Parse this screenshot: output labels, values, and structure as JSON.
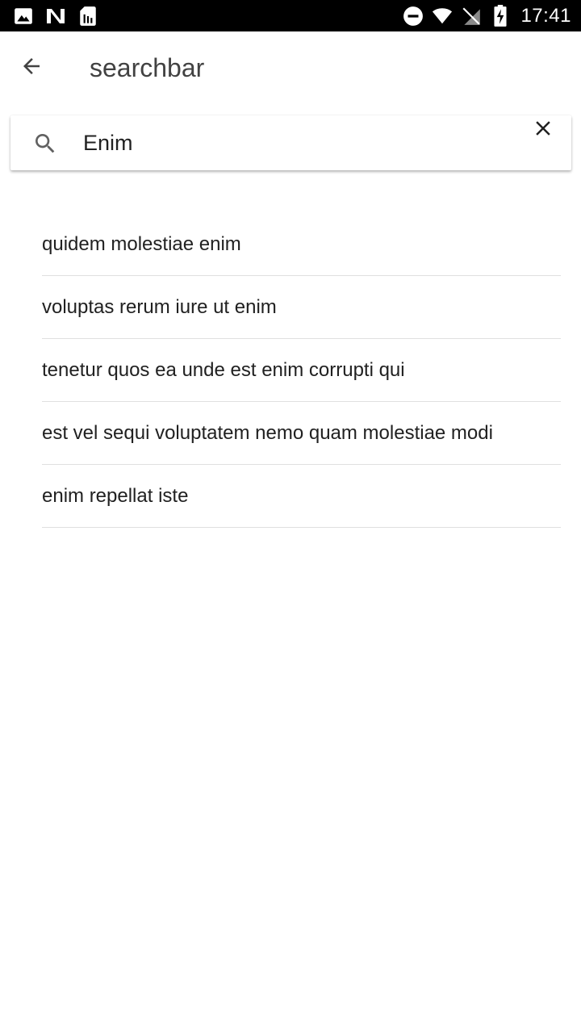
{
  "status_bar": {
    "time": "17:41",
    "left_icons": [
      "image-icon",
      "n-badge-icon",
      "sim-card-icon"
    ],
    "right_icons": [
      "do-not-disturb-icon",
      "wifi-icon",
      "no-sim-icon",
      "battery-charging-icon"
    ]
  },
  "app_bar": {
    "back_icon": "arrow-back-icon",
    "title": "searchbar"
  },
  "search": {
    "icon": "search-icon",
    "value": "Enim",
    "clear_icon": "close-icon"
  },
  "results": [
    {
      "text": "quidem molestiae enim"
    },
    {
      "text": "voluptas rerum iure ut enim"
    },
    {
      "text": "tenetur quos ea unde est enim corrupti qui"
    },
    {
      "text": "est vel sequi voluptatem nemo quam molestiae modi"
    },
    {
      "text": "enim repellat iste"
    }
  ],
  "colors": {
    "status_bar_bg": "#000000",
    "title_text": "#424242",
    "body_text": "#212121",
    "divider": "#e0e0e0"
  }
}
